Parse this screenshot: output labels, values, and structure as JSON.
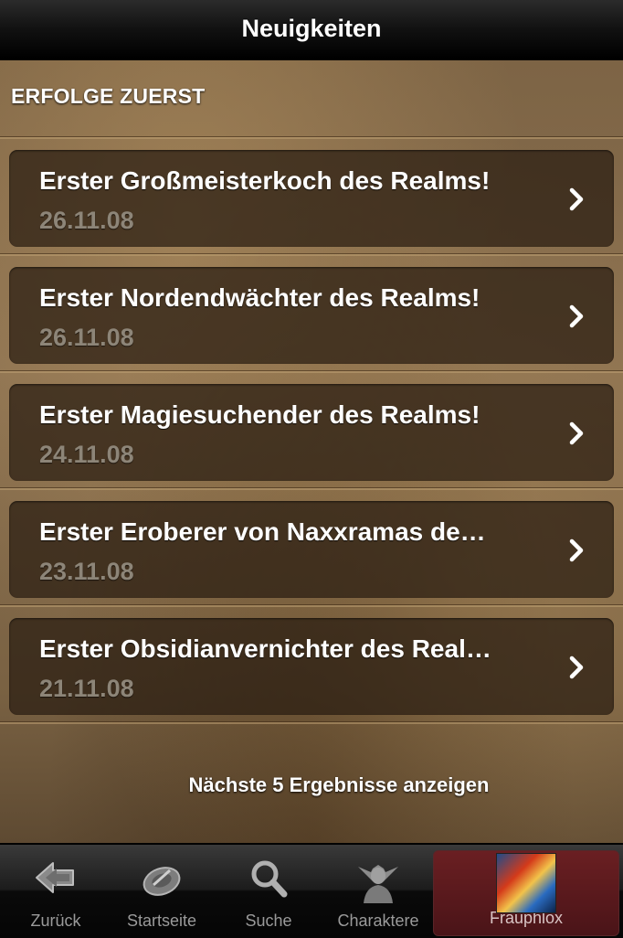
{
  "navbar": {
    "title": "Neuigkeiten"
  },
  "section": {
    "header": "ERFOLGE ZUERST"
  },
  "items": [
    {
      "title": "Erster Großmeisterkoch des Realms!",
      "date": "26.11.08"
    },
    {
      "title": "Erster Nordendwächter des Realms!",
      "date": "26.11.08"
    },
    {
      "title": "Erster Magiesuchender des Realms!",
      "date": "24.11.08"
    },
    {
      "title": "Erster Eroberer von Naxxramas de…",
      "date": "23.11.08"
    },
    {
      "title": "Erster Obsidianvernichter des Real…",
      "date": "21.11.08"
    }
  ],
  "more_label": "Nächste 5 Ergebnisse anzeigen",
  "tabs": [
    {
      "label": "Zurück",
      "icon": "back-arrow-icon"
    },
    {
      "label": "Startseite",
      "icon": "home-emblem-icon"
    },
    {
      "label": "Suche",
      "icon": "magnifier-icon"
    },
    {
      "label": "Charaktere",
      "icon": "character-icon"
    },
    {
      "label": "Frauphlox",
      "icon": "character-avatar",
      "active": true
    }
  ],
  "colors": {
    "title_text": "#ffffff",
    "date_text": "#8d8578",
    "active_tab": "#6a1f22"
  }
}
